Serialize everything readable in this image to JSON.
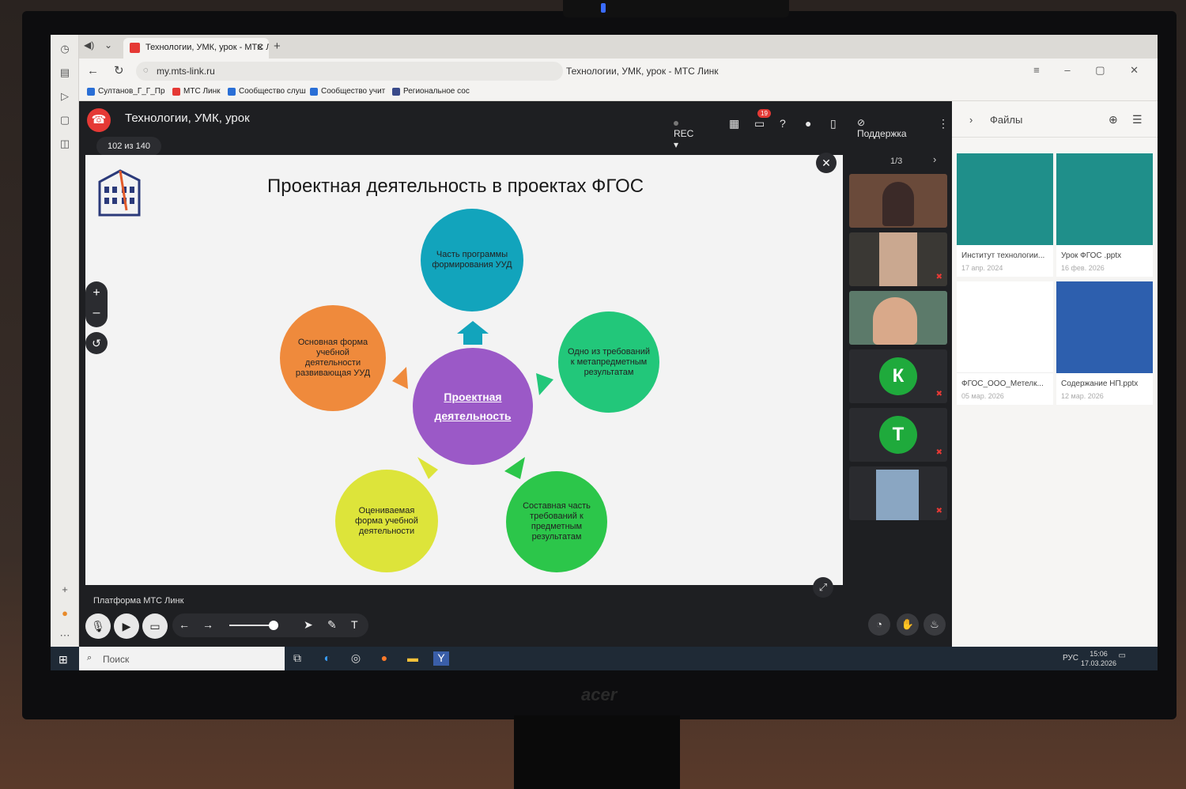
{
  "browser": {
    "tab_title": "Технологии, УМК, урок - МТС Линк",
    "url": "my.mts-link.ru",
    "page_title": "Технологии, УМК, урок - МТС Линк",
    "bookmarks": [
      "Султанов_Г_Г_Пр",
      "МТС Линк",
      "Сообщество слуш",
      "Сообщество учит",
      "Региональное сос"
    ]
  },
  "app": {
    "room_title": "Технологии, УМК, урок",
    "rec_label": "REC",
    "chat_badge": "19",
    "support_label": "Поддержка",
    "slide_counter": "102 из 140",
    "platform_label": "Платформа МТС Линк",
    "participants_page": "1/3"
  },
  "slide": {
    "title": "Проектная деятельность в проектах ФГОС",
    "center": "Проектная деятельность",
    "top": "Часть программы формирования УУД",
    "left": "Основная форма учебной деятельности развивающая УУД",
    "right": "Одно из требований к метапредметным результатам",
    "bottom_left": "Оцениваемая форма учебной деятельности",
    "bottom_right": "Составная часть требований к предметным результатам",
    "colors": {
      "top": "#12a4bc",
      "left": "#ef8a3c",
      "right": "#22c77a",
      "bottom_left": "#dde43a",
      "bottom_right": "#2cc64a",
      "center": "#9b59c7"
    }
  },
  "participants": {
    "letters": [
      "К",
      "Т"
    ]
  },
  "files": {
    "header": "Файлы",
    "items": [
      {
        "name": "Институт технологии...",
        "date": "17 апр. 2024"
      },
      {
        "name": "Урок ФГОС .pptx",
        "date": "16 фев. 2026"
      },
      {
        "name": "ФГОС_ООО_Метелк...",
        "date": "05 мар. 2026"
      },
      {
        "name": "Содержание НП.pptx",
        "date": "12 мар. 2026"
      }
    ]
  },
  "taskbar": {
    "search_placeholder": "Поиск",
    "lang": "РУС",
    "time": "15:06",
    "date": "17.03.2026"
  }
}
